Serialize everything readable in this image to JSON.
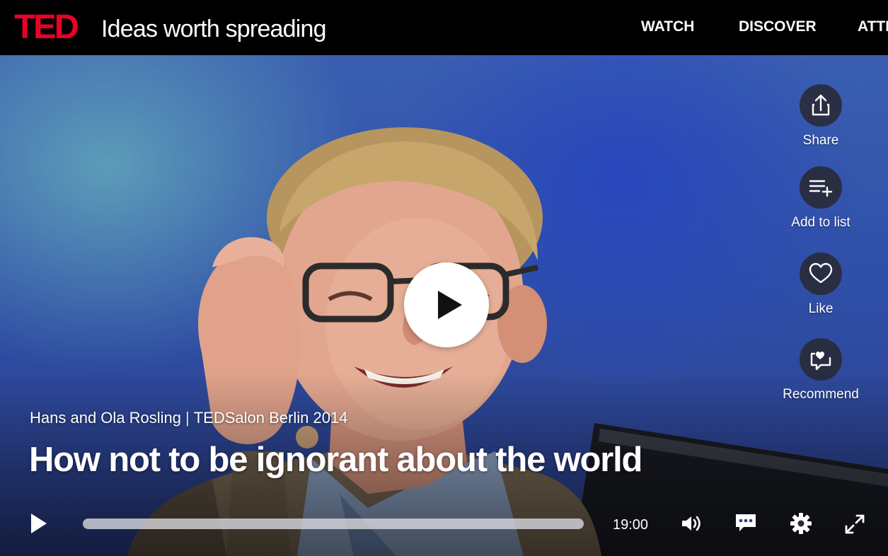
{
  "header": {
    "logo_text": "TED",
    "tagline": "Ideas worth spreading",
    "nav": [
      {
        "label": "WATCH"
      },
      {
        "label": "DISCOVER"
      },
      {
        "label": "ATTEND"
      }
    ],
    "brand_color": "#eb0028"
  },
  "player": {
    "big_play_icon": "play-icon",
    "actions": [
      {
        "label": "Share",
        "icon": "share-icon"
      },
      {
        "label": "Add to list",
        "icon": "add-to-list-icon"
      },
      {
        "label": "Like",
        "icon": "heart-icon"
      },
      {
        "label": "Recommend",
        "icon": "recommend-icon"
      }
    ],
    "talk": {
      "speaker": "Hans and Ola Rosling",
      "separator": "|",
      "event": "TEDSalon Berlin 2014",
      "title": "How not to be ignorant about the world"
    },
    "controls": {
      "duration": "19:00",
      "progress": 0,
      "icons": [
        "play-icon",
        "volume-icon",
        "captions-icon",
        "settings-gear-icon",
        "fullscreen-icon"
      ]
    }
  }
}
